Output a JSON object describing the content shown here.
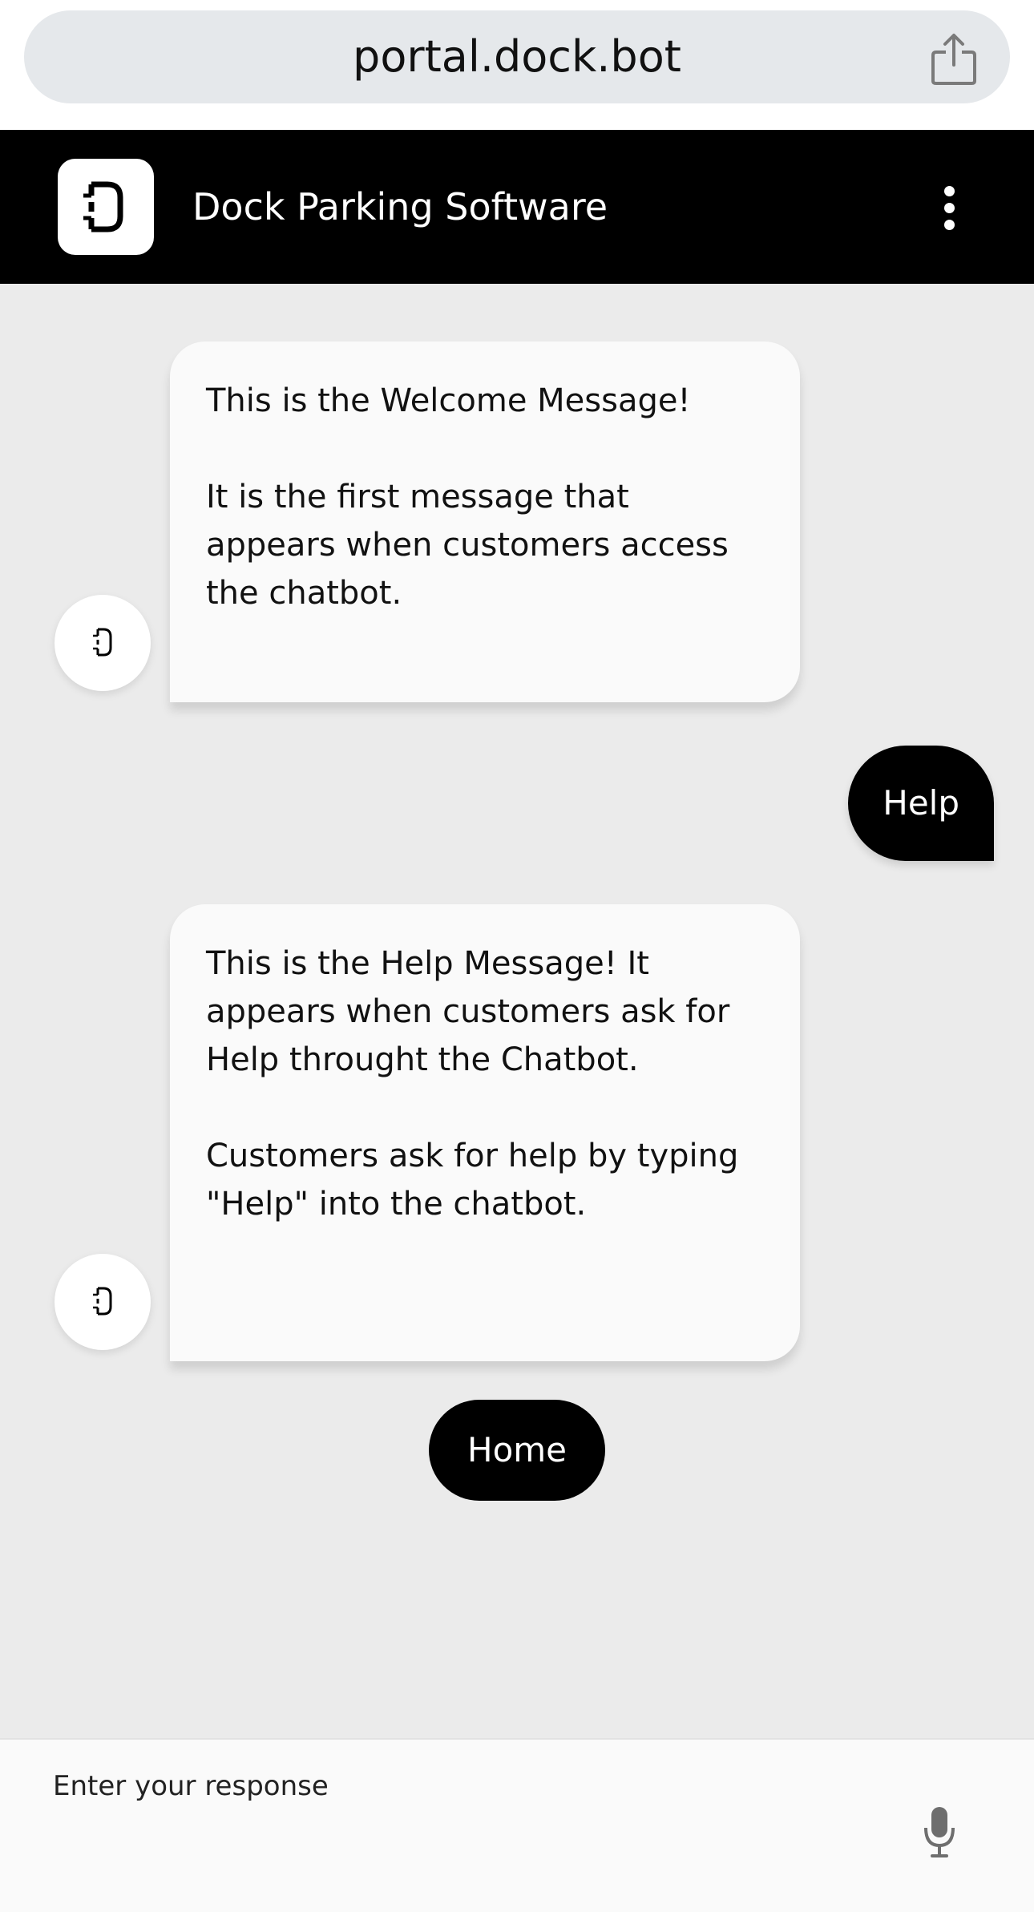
{
  "browser": {
    "url": "portal.dock.bot",
    "share_icon": "share-icon"
  },
  "header": {
    "title": "Dock Parking Software",
    "logo_icon": "dock-logo-icon",
    "menu_icon": "more-vertical-icon"
  },
  "messages": [
    {
      "from": "bot",
      "paragraphs": [
        "This is the Welcome Message!",
        "It is the first message that appears when customers access the chatbot."
      ]
    },
    {
      "from": "user",
      "text": "Help"
    },
    {
      "from": "bot",
      "paragraphs": [
        "This is the Help Message! It appears when customers ask for Help throught the Chatbot.",
        "Customers ask for help by typing \"Help\" into the chatbot."
      ]
    }
  ],
  "quick_reply": {
    "label": "Home"
  },
  "input": {
    "placeholder": "Enter your response",
    "value": "",
    "mic_icon": "microphone-icon"
  },
  "colors": {
    "header_bg": "#000000",
    "chat_bg": "#ebebeb",
    "bot_bubble": "#fafafa",
    "user_bubble": "#000000"
  }
}
